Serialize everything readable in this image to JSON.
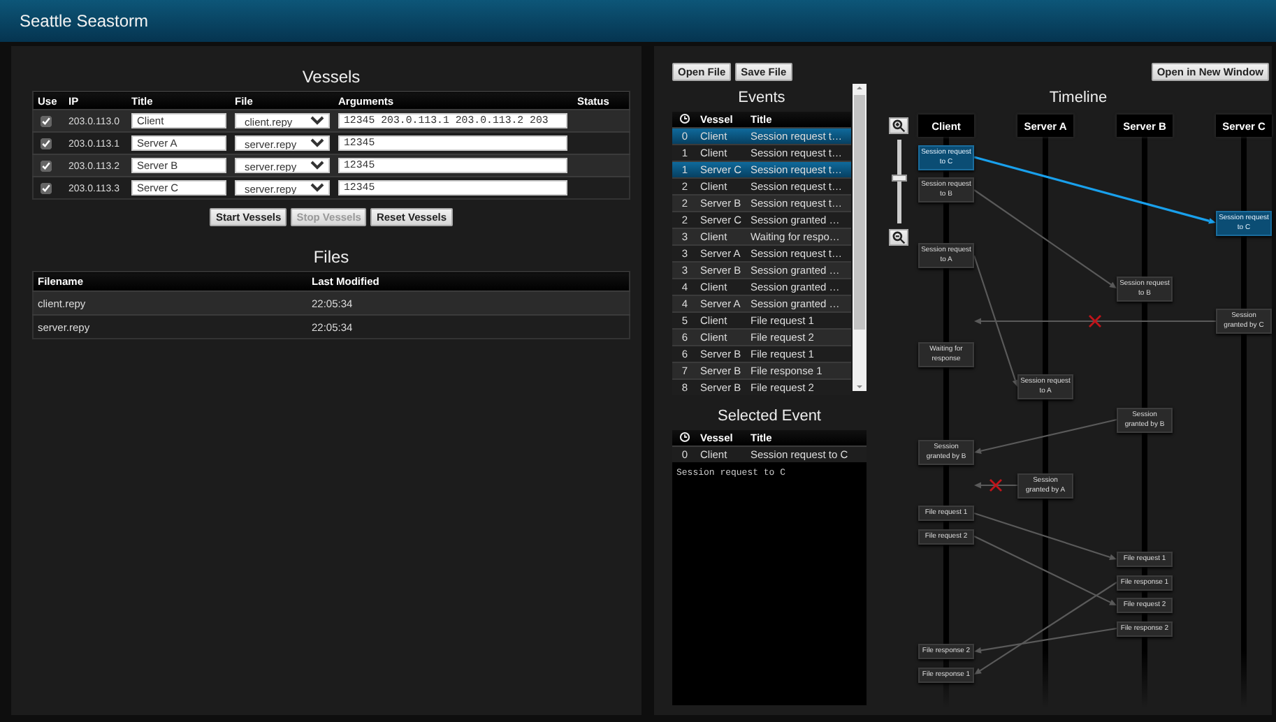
{
  "header": {
    "title": "Seattle Seastorm"
  },
  "vessels": {
    "title": "Vessels",
    "columns": [
      "Use",
      "IP",
      "Title",
      "File",
      "Arguments",
      "Status"
    ],
    "rows": [
      {
        "checked": true,
        "ip": "203.0.113.0",
        "title": "Client",
        "file": "client.repy",
        "arguments": "12345 203.0.113.1 203.0.113.2 203"
      },
      {
        "checked": true,
        "ip": "203.0.113.1",
        "title": "Server A",
        "file": "server.repy",
        "arguments": "12345"
      },
      {
        "checked": true,
        "ip": "203.0.113.2",
        "title": "Server B",
        "file": "server.repy",
        "arguments": "12345"
      },
      {
        "checked": true,
        "ip": "203.0.113.3",
        "title": "Server C",
        "file": "server.repy",
        "arguments": "12345"
      }
    ],
    "buttons": [
      {
        "label": "Start Vessels",
        "disabled": false
      },
      {
        "label": "Stop Vessels",
        "disabled": true
      },
      {
        "label": "Reset Vessels",
        "disabled": false
      }
    ]
  },
  "files": {
    "title": "Files",
    "columns": [
      "Filename",
      "Last Modified"
    ],
    "rows": [
      [
        "client.repy",
        "22:05:34"
      ],
      [
        "server.repy",
        "22:05:34"
      ]
    ]
  },
  "toolbar": {
    "buttons": [
      "Open File",
      "Save File"
    ],
    "open_window": "Open in New Window"
  },
  "events": {
    "title": "Events",
    "columns": [
      "Vessel",
      "Title"
    ],
    "rows": [
      {
        "time": "0",
        "vessel": "Client",
        "title": "Session request t…",
        "selected": true
      },
      {
        "time": "1",
        "vessel": "Client",
        "title": "Session request t…",
        "selected": false
      },
      {
        "time": "1",
        "vessel": "Server C",
        "title": "Session request t…",
        "selected": true
      },
      {
        "time": "2",
        "vessel": "Client",
        "title": "Session request t…",
        "selected": false
      },
      {
        "time": "2",
        "vessel": "Server B",
        "title": "Session request t…",
        "selected": false
      },
      {
        "time": "2",
        "vessel": "Server C",
        "title": "Session granted …",
        "selected": false
      },
      {
        "time": "3",
        "vessel": "Client",
        "title": "Waiting for respo…",
        "selected": false
      },
      {
        "time": "3",
        "vessel": "Server A",
        "title": "Session request t…",
        "selected": false
      },
      {
        "time": "3",
        "vessel": "Server B",
        "title": "Session granted …",
        "selected": false
      },
      {
        "time": "4",
        "vessel": "Client",
        "title": "Session granted …",
        "selected": false
      },
      {
        "time": "4",
        "vessel": "Server A",
        "title": "Session granted …",
        "selected": false
      },
      {
        "time": "5",
        "vessel": "Client",
        "title": "File request 1",
        "selected": false
      },
      {
        "time": "6",
        "vessel": "Client",
        "title": "File request 2",
        "selected": false
      },
      {
        "time": "6",
        "vessel": "Server B",
        "title": "File request 1",
        "selected": false
      },
      {
        "time": "7",
        "vessel": "Server B",
        "title": "File response 1",
        "selected": false
      },
      {
        "time": "8",
        "vessel": "Server B",
        "title": "File request 2",
        "selected": false
      }
    ]
  },
  "selected_event": {
    "title": "Selected Event",
    "columns": [
      "Vessel",
      "Title"
    ],
    "row": {
      "time": "0",
      "vessel": "Client",
      "title": "Session request to C"
    },
    "detail": "Session request to C"
  },
  "timeline": {
    "title": "Timeline",
    "zoom": {
      "level": 0.55
    },
    "lanes": [
      "Client",
      "Server A",
      "Server B",
      "Server C"
    ],
    "rows": [
      {
        "cells": [
          {
            "text": "Session request to C",
            "selected": true,
            "message": {
              "selected": true,
              "dropped": false
            }
          },
          null,
          null,
          null
        ]
      },
      {
        "cells": [
          {
            "text": "Session request to B",
            "selected": false,
            "message": {
              "selected": false,
              "dropped": false
            }
          },
          null,
          null,
          null
        ]
      },
      {
        "cells": [
          null,
          null,
          null,
          {
            "text": "Session request to C",
            "selected": true
          }
        ]
      },
      {
        "cells": [
          {
            "text": "Session request to A",
            "selected": false,
            "message": {
              "selected": false,
              "dropped": false
            }
          },
          null,
          null,
          null
        ]
      },
      {
        "cells": [
          null,
          null,
          {
            "text": "Session request to B",
            "selected": false
          },
          null
        ]
      },
      {
        "cells": [
          null,
          null,
          null,
          {
            "text": "Session granted by C",
            "selected": false,
            "message": {
              "selected": false,
              "dropped": true
            }
          }
        ]
      },
      {
        "cells": [
          {
            "text": "Waiting for response",
            "selected": false
          },
          null,
          null,
          null
        ]
      },
      {
        "cells": [
          null,
          {
            "text": "Session request to A",
            "selected": false
          },
          null,
          null
        ]
      },
      {
        "cells": [
          null,
          null,
          {
            "text": "Session granted by B",
            "selected": false,
            "message": {
              "selected": false,
              "dropped": false
            }
          },
          null
        ]
      },
      {
        "cells": [
          {
            "text": "Session granted by B",
            "selected": false
          },
          null,
          null,
          null
        ]
      },
      {
        "cells": [
          null,
          {
            "text": "Session granted by A",
            "selected": false,
            "message": {
              "selected": false,
              "dropped": true
            }
          },
          null,
          null
        ]
      },
      {
        "cells": [
          {
            "text": "File request 1",
            "selected": false,
            "message": {
              "selected": false,
              "dropped": false
            }
          },
          null,
          null,
          null
        ]
      },
      {
        "cells": [
          {
            "text": "File request 2",
            "selected": false,
            "message": {
              "selected": false,
              "dropped": false
            }
          },
          null,
          null,
          null
        ]
      },
      {
        "cells": [
          null,
          null,
          {
            "text": "File request 1",
            "selected": false
          },
          null
        ]
      },
      {
        "cells": [
          null,
          null,
          {
            "text": "File response 1",
            "selected": false,
            "message": {
              "selected": false,
              "dropped": false
            }
          },
          null
        ]
      },
      {
        "cells": [
          null,
          null,
          {
            "text": "File request 2",
            "selected": false
          },
          null
        ]
      },
      {
        "cells": [
          null,
          null,
          {
            "text": "File response 2",
            "selected": false,
            "message": {
              "selected": false,
              "dropped": false
            }
          },
          null
        ]
      },
      {
        "cells": [
          {
            "text": "File response 2",
            "selected": false
          },
          null,
          null,
          null
        ]
      },
      {
        "cells": [
          {
            "text": "File response 1",
            "selected": false
          },
          null,
          null,
          null
        ]
      }
    ]
  }
}
